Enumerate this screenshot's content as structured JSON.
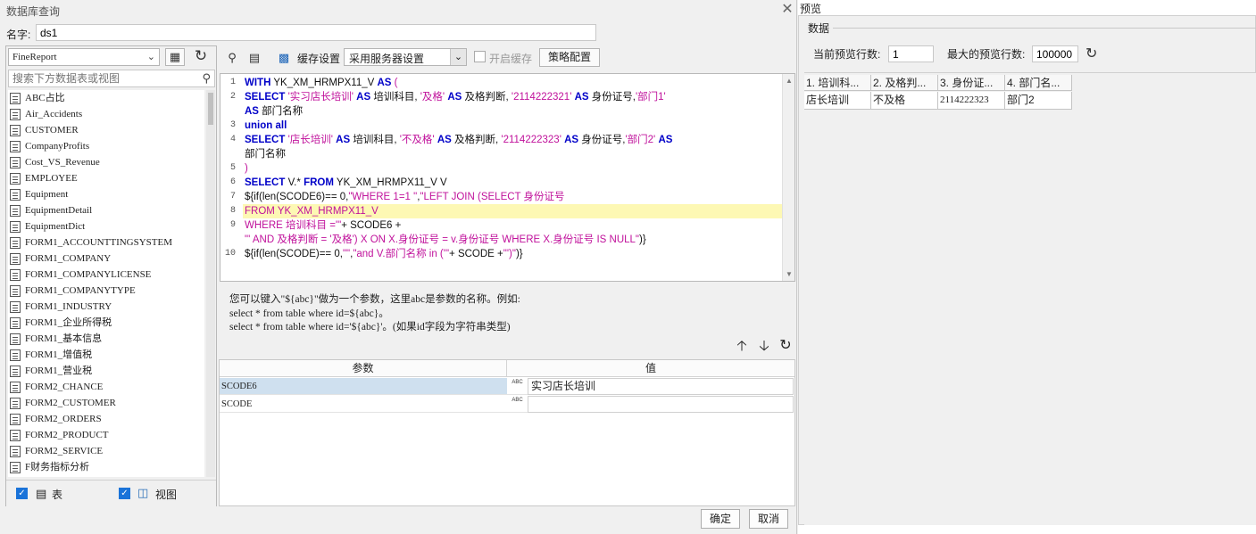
{
  "dialog": {
    "title": "数据库查询",
    "name_label": "名字:",
    "name_value": "ds1",
    "ok_label": "确定",
    "cancel_label": "取消"
  },
  "left": {
    "connection": "FineReport",
    "search_placeholder": "搜索下方数据表或视图",
    "tables": [
      "ABC占比",
      "Air_Accidents",
      "CUSTOMER",
      "CompanyProfits",
      "Cost_VS_Revenue",
      "EMPLOYEE",
      "Equipment",
      "EquipmentDetail",
      "EquipmentDict",
      "FORM1_ACCOUNTTINGSYSTEM",
      "FORM1_COMPANY",
      "FORM1_COMPANYLICENSE",
      "FORM1_COMPANYTYPE",
      "FORM1_INDUSTRY",
      "FORM1_企业所得税",
      "FORM1_基本信息",
      "FORM1_增值税",
      "FORM1_营业税",
      "FORM2_CHANCE",
      "FORM2_CUSTOMER",
      "FORM2_ORDERS",
      "FORM2_PRODUCT",
      "FORM2_SERVICE",
      "F财务指标分析"
    ],
    "show_tables_label": "表",
    "show_views_label": "视图"
  },
  "toolbar": {
    "cache_settings_label": "缓存设置",
    "cache_mode": "采用服务器设置",
    "enable_cache_label": "开启缓存",
    "policy_label": "策略配置"
  },
  "sql": {
    "line_numbers": [
      "1",
      "2",
      "3",
      "4",
      "5",
      "6",
      "7",
      "8",
      "9",
      "10"
    ],
    "l1a": "WITH",
    "l1b": " YK_XM_HRMPX11_V ",
    "l1c": "AS",
    "l1d": " (",
    "l2a": "SELECT",
    "l2b": " '实习店长培训' ",
    "l2c": "AS",
    "l2d": " 培训科目, ",
    "l2e": "'及格'",
    "l2f": " AS",
    "l2g": " 及格判断, ",
    "l2h": "'2114222321'",
    "l2i": " AS",
    "l2j": " 身份证号,",
    "l2k": "'部门1'",
    "l2l": "AS",
    "l2m": " 部门名称",
    "l3": "union all",
    "l4a": "SELECT",
    "l4b": " '店长培训' ",
    "l4c": "AS",
    "l4d": " 培训科目, ",
    "l4e": "'不及格'",
    "l4f": " AS",
    "l4g": " 及格判断, ",
    "l4h": "'2114222323'",
    "l4i": " AS",
    "l4j": " 身份证号,",
    "l4k": "'部门2'",
    "l4l": " AS",
    "l4m": "部门名称",
    "l5": ")",
    "l6a": "SELECT",
    "l6b": " V.* ",
    "l6c": "FROM",
    "l6d": " YK_XM_HRMPX11_V V",
    "l7a": "${if(len(SCODE6)== 0,",
    "l7b": "\"WHERE 1=1 \"",
    "l7c": ",",
    "l7d": "\"LEFT JOIN (SELECT 身份证号",
    "l8": "FROM YK_XM_HRMPX11_V",
    "l9a": "WHERE 培训科目 ='\"",
    "l9b": "+ SCODE6 +",
    "l9c": "\"' AND 及格判断 = '及格') X ON X.身份证号 = v.身份证号 WHERE X.身份证号 IS NULL\"",
    "l9d": ")}",
    "l10a": "${if(len(SCODE)== 0,",
    "l10b": "\"\"",
    "l10c": ",",
    "l10d": "\"and V.部门名称 in ('\"",
    "l10e": "+ SCODE +",
    "l10f": "\"')\"",
    "l10g": ")}"
  },
  "hint": {
    "line1": "您可以键入\"${abc}\"做为一个参数，这里abc是参数的名称。例如:",
    "line2": "select * from table where id=${abc}。",
    "line3": "select * from table where id='${abc}'。(如果id字段为字符串类型)"
  },
  "params": {
    "col_name": "参数",
    "col_value": "值",
    "type_badge": "ABC",
    "rows": [
      {
        "name": "SCODE6",
        "value": "实习店长培训"
      },
      {
        "name": "SCODE",
        "value": ""
      }
    ]
  },
  "preview": {
    "title": "预览",
    "group_label": "数据",
    "current_rows_label": "当前预览行数:",
    "current_rows_value": "1",
    "max_rows_label": "最大的预览行数:",
    "max_rows_value": "100000",
    "columns": [
      "1. 培训科...",
      "2. 及格判...",
      "3. 身份证...",
      "4. 部门名..."
    ],
    "row": [
      "店长培训",
      "不及格",
      "2114222323",
      "部门2"
    ]
  },
  "colors": {
    "keyword": "#0000c8",
    "string": "#c0119b",
    "highlight": "#fdf8b4",
    "selected_row": "#cfe0ef",
    "checkbox": "#1a73d9"
  }
}
